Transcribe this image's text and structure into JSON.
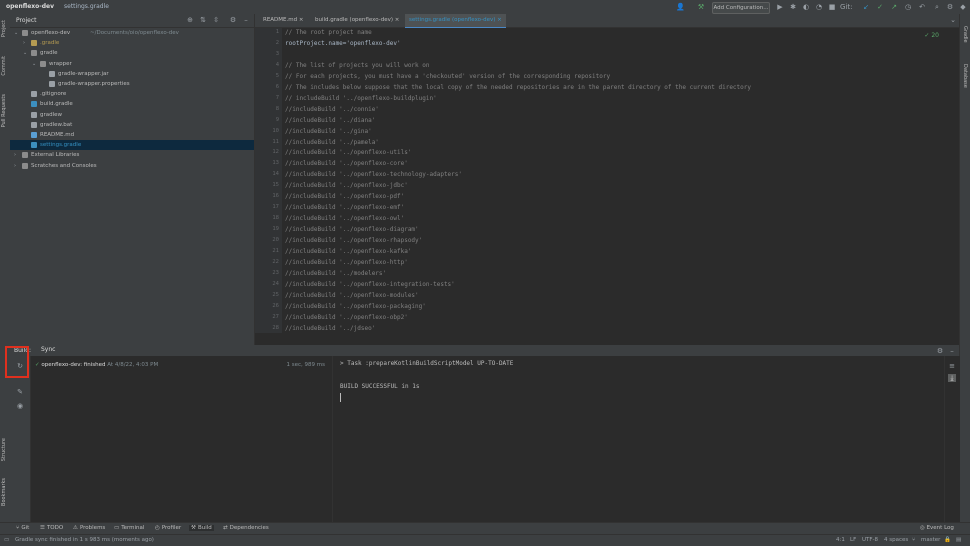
{
  "titlebar": {
    "project": "openflexo-dev",
    "file": "settings.gradle",
    "run_config": "Add Configuration...",
    "git_label": "Git:"
  },
  "left_strip": [
    "Project",
    "Commit",
    "Pull Requests",
    "Structure",
    "Bookmarks"
  ],
  "right_strip": [
    "Gradle",
    "Database"
  ],
  "project_panel": {
    "title": "Project",
    "tree": [
      {
        "label": "openflexo-dev",
        "hint": "~/Documents/oio/openflexo-dev",
        "depth": 0,
        "icon": "folder",
        "expanded": true
      },
      {
        "label": ".gradle",
        "hint": "",
        "depth": 1,
        "icon": "folder-y",
        "expanded": false
      },
      {
        "label": "gradle",
        "hint": "",
        "depth": 1,
        "icon": "folder",
        "expanded": true
      },
      {
        "label": "wrapper",
        "hint": "",
        "depth": 2,
        "icon": "folder",
        "expanded": true
      },
      {
        "label": "gradle-wrapper.jar",
        "hint": "",
        "depth": 3,
        "icon": "file-t"
      },
      {
        "label": "gradle-wrapper.properties",
        "hint": "",
        "depth": 3,
        "icon": "file-t"
      },
      {
        "label": ".gitignore",
        "hint": "",
        "depth": 1,
        "icon": "file-t"
      },
      {
        "label": "build.gradle",
        "hint": "",
        "depth": 1,
        "icon": "file-g"
      },
      {
        "label": "gradlew",
        "hint": "",
        "depth": 1,
        "icon": "file-t"
      },
      {
        "label": "gradlew.bat",
        "hint": "",
        "depth": 1,
        "icon": "file-t"
      },
      {
        "label": "README.md",
        "hint": "",
        "depth": 1,
        "icon": "file-md"
      },
      {
        "label": "settings.gradle",
        "hint": "",
        "depth": 1,
        "icon": "file-g",
        "selected": true
      },
      {
        "label": "External Libraries",
        "hint": "",
        "depth": 0,
        "icon": "folder",
        "expanded": false
      },
      {
        "label": "Scratches and Consoles",
        "hint": "",
        "depth": 0,
        "icon": "folder",
        "expanded": false
      }
    ]
  },
  "editor": {
    "tabs": [
      {
        "label": "README.md",
        "active": false
      },
      {
        "label": "build.gradle (openflexo-dev)",
        "active": false
      },
      {
        "label": "settings.gradle (openflexo-dev)",
        "active": true
      }
    ],
    "inspection_count": "20",
    "line_numbers": [
      "1",
      "2",
      "3",
      "4",
      "5",
      "6",
      "7",
      "8",
      "9",
      "10",
      "11",
      "12",
      "13",
      "14",
      "15",
      "16",
      "17",
      "18",
      "19",
      "20",
      "21",
      "22",
      "23",
      "24",
      "25",
      "26",
      "27",
      "28"
    ],
    "lines": [
      "// The root project name",
      "rootProject.name='openflexo-dev'",
      "",
      "// The list of projects you will work on",
      "// For each projects, you must have a 'checkouted' version of the corresponding repository",
      "// The includes below suppose that the local copy of the needed repositories are in the parent directory of the current directory",
      "// includeBuild '../openflexo-buildplugin'",
      "//includeBuild '../connie'",
      "//includeBuild '../diana'",
      "//includeBuild '../gina'",
      "//includeBuild '../pamela'",
      "//includeBuild '../openflexo-utils'",
      "//includeBuild '../openflexo-core'",
      "//includeBuild '../openflexo-technology-adapters'",
      "//includeBuild '../openflexo-jdbc'",
      "//includeBuild '../openflexo-pdf'",
      "//includeBuild '../openflexo-emf'",
      "//includeBuild '../openflexo-owl'",
      "//includeBuild '../openflexo-diagram'",
      "//includeBuild '../openflexo-rhapsody'",
      "//includeBuild '../openflexo-kafka'",
      "//includeBuild '../openflexo-http'",
      "//includeBuild '../modelers'",
      "//includeBuild '../openflexo-integration-tests'",
      "//includeBuild '../openflexo-modules'",
      "//includeBuild '../openflexo-packaging'",
      "//includeBuild '../openflexo-obp2'",
      "//includeBuild '../jdseo'"
    ],
    "current_line": "24"
  },
  "build_panel": {
    "build_tab": "Build:",
    "sync_tab": "Sync",
    "tree_item": "openflexo-dev: finished",
    "tree_item_time": "At 4/8/22, 4:03 PM",
    "tree_item_duration": "1 sec, 989 ms",
    "output": [
      "> Task :prepareKotlinBuildScriptModel UP-TO-DATE",
      "",
      "BUILD SUCCESSFUL in 1s"
    ]
  },
  "toolwindows": [
    {
      "label": "Git",
      "icon": "git-icon",
      "active": false
    },
    {
      "label": "TODO",
      "icon": "list-icon",
      "active": false
    },
    {
      "label": "Problems",
      "icon": "problems-icon",
      "active": false
    },
    {
      "label": "Terminal",
      "icon": "terminal-icon",
      "active": false
    },
    {
      "label": "Profiler",
      "icon": "profiler-icon",
      "active": false
    },
    {
      "label": "Build",
      "icon": "hammer-icon",
      "active": true
    },
    {
      "label": "Dependencies",
      "icon": "dependencies-icon",
      "active": false
    }
  ],
  "event_log": "Event Log",
  "statusbar": {
    "message": "Gradle sync finished in 1 s 983 ms (moments ago)",
    "position": "4:1",
    "line_sep": "LF",
    "encoding": "UTF-8",
    "indent": "4 spaces",
    "branch": "master"
  },
  "colors": {
    "accent": "#4a88c7",
    "highlight_box": "#e0301e",
    "success": "#59a869"
  }
}
